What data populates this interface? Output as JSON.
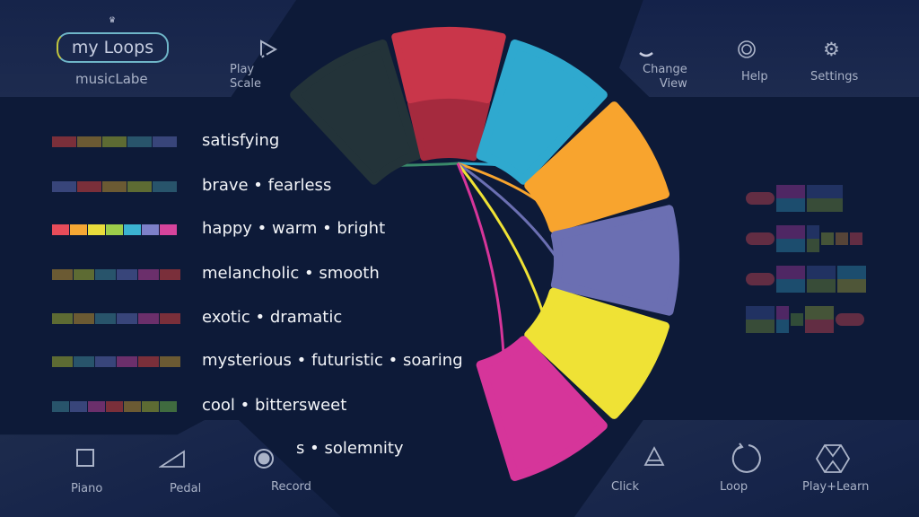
{
  "header": {
    "logo_text": "my Loops",
    "app_name": "musicLabe",
    "play_scale": "Play\nScale",
    "change_view": "Change\nView",
    "help": "Help",
    "settings": "Settings"
  },
  "colors": {
    "background": "#0d1a38",
    "pads": [
      "#233339",
      "#d8384a",
      "#2fa9cf",
      "#f8a42e",
      "#6b6fb2",
      "#efe235",
      "#d6359a"
    ]
  },
  "moods": [
    {
      "label": "satisfying",
      "swatches": [
        "#7a2f3a",
        "#6b5a33",
        "#5d6b33",
        "#28546b",
        "#38457a"
      ]
    },
    {
      "label": "brave • fearless",
      "swatches": [
        "#38457a",
        "#7a2f3a",
        "#6b5a33",
        "#5d6b33",
        "#28546b"
      ]
    },
    {
      "label": "happy • warm • bright",
      "swatches": [
        "#e74c5a",
        "#f5a734",
        "#e8dc3c",
        "#9ccd4a",
        "#3bb3d0",
        "#7d80c9",
        "#d6449c"
      ]
    },
    {
      "label": "melancholic • smooth",
      "swatches": [
        "#6b5a33",
        "#5d6b33",
        "#28546b",
        "#38457a",
        "#6b2f6b",
        "#7a2f3a"
      ]
    },
    {
      "label": "exotic • dramatic",
      "swatches": [
        "#5d6b33",
        "#6b5a33",
        "#28546b",
        "#38457a",
        "#6b2f6b",
        "#7a2f3a"
      ]
    },
    {
      "label": "mysterious • futuristic • soaring",
      "swatches": [
        "#5d6b33",
        "#28546b",
        "#38457a",
        "#6b2f6b",
        "#7a2f3a",
        "#6b5a33"
      ]
    },
    {
      "label": "cool • bittersweet",
      "swatches": [
        "#28546b",
        "#38457a",
        "#6b2f6b",
        "#7a2f3a",
        "#6b5a33",
        "#5d6b33",
        "#3f6b3f"
      ]
    },
    {
      "label": "s • solemnity",
      "swatches": []
    }
  ],
  "footer": {
    "piano": "Piano",
    "pedal": "Pedal",
    "record": "Record",
    "click": "Click",
    "loop": "Loop",
    "play_learn": "Play+Learn"
  }
}
